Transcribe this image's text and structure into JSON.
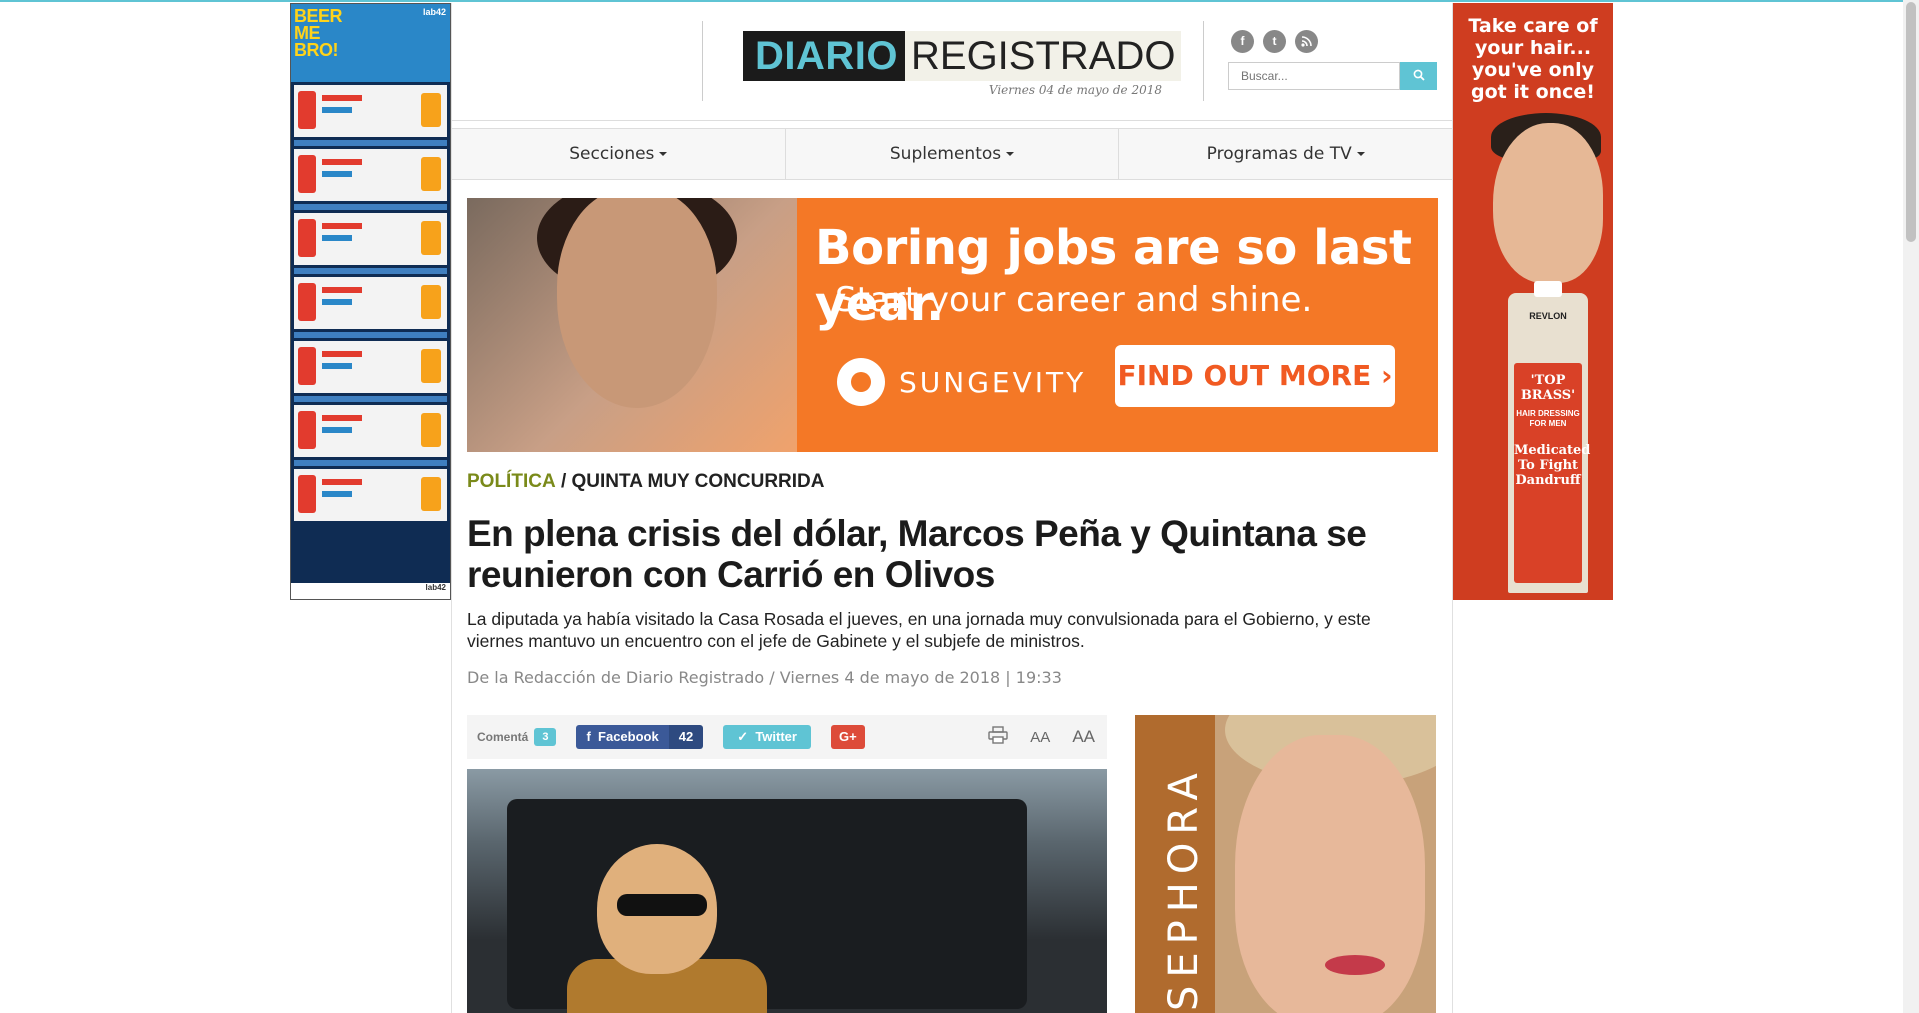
{
  "ads": {
    "left": {
      "headline": "BEER ME BRO!",
      "brand": "lab42",
      "footer": "lab42"
    },
    "right": {
      "headline": "Take care of your hair... you've only got it once!",
      "brand": "REVLON",
      "product": "'TOP BRASS'",
      "product_sub": "HAIR DRESSING FOR MEN",
      "claim": "Medicated To Fight Dandruff"
    },
    "banner": {
      "headline": "Boring jobs are so last year.",
      "subline": "Start your career and shine.",
      "brand": "SUNGEVITY",
      "cta": "FIND OUT MORE ›"
    },
    "sidebar": {
      "brand": "SEPHORA"
    }
  },
  "header": {
    "logo_part1": "DIARIO",
    "logo_part2": "REGISTRADO",
    "date": "Viernes 04 de mayo de 2018",
    "social": [
      "f",
      "t",
      "rss"
    ],
    "search": {
      "placeholder": "Buscar...",
      "icon": "search-icon"
    }
  },
  "nav": {
    "items": [
      "Secciones",
      "Suplementos",
      "Programas de TV"
    ]
  },
  "article": {
    "category": "POLÍTICA",
    "subcategory": "/ QUINTA MUY CONCURRIDA",
    "title": "En plena crisis del dólar, Marcos Peña y Quintana se reunieron con Carrió en Olivos",
    "lead": "La diputada ya había visitado la Casa Rosada el jueves, en una jornada muy convulsionada para el Gobierno, y este viernes mantuvo un encuentro con el jefe de Gabinete y el subjefe de ministros.",
    "byline": "De la Redacción de Diario Registrado / Viernes 4 de mayo de 2018 | 19:33"
  },
  "share": {
    "comment_label": "Comentá",
    "comment_count": "3",
    "facebook_label": "Facebook",
    "facebook_count": "42",
    "twitter_label": "Twitter",
    "gplus_label": "G+",
    "font_small": "AA",
    "font_large": "AA"
  },
  "colors": {
    "accent": "#5fc4d4",
    "category": "#7a8a1a",
    "facebook": "#3b5998",
    "gplus": "#dd4b39"
  }
}
